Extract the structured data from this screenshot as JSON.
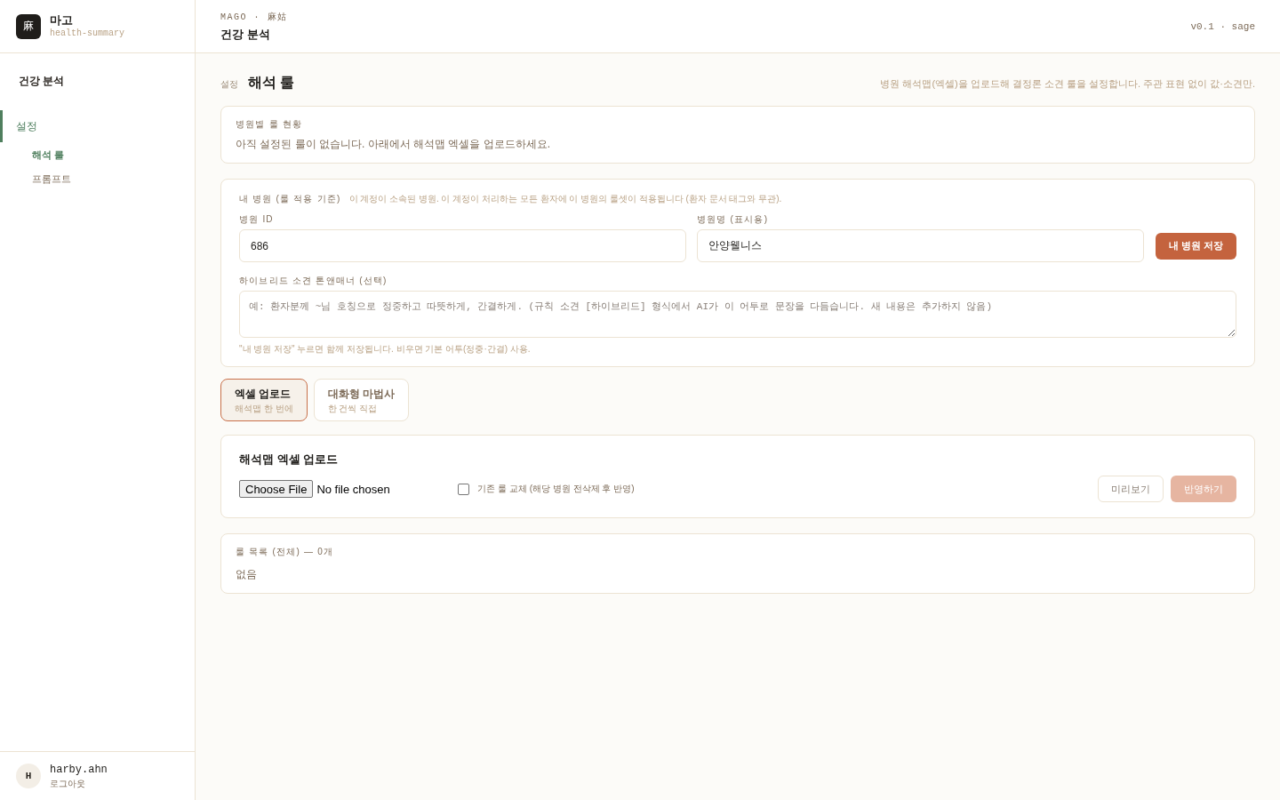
{
  "sidebar": {
    "logo": {
      "glyph": "麻",
      "name": "마고",
      "subtitle": "health-summary"
    },
    "section_title": "건강 분석",
    "nav": [
      {
        "label": "설정",
        "selected": true,
        "children": [
          {
            "label": "해석 룰",
            "selected": true
          },
          {
            "label": "프롬프트",
            "selected": false
          }
        ]
      }
    ],
    "user": {
      "avatar": "H",
      "name": "harby.ahn",
      "action": "로그아웃"
    }
  },
  "header": {
    "breadcrumb": "MAGO · 麻姑",
    "title": "건강 분석",
    "version": "v0.1 · sage"
  },
  "page": {
    "eyebrow": "설정",
    "title": "해석 룰",
    "description": "병원 해석맵(엑셀)을 업로드해 결정론 소견 룰을 설정합니다. 주관 표현 없이 값·소견만."
  },
  "status_card": {
    "title": "병원별 룰 현황",
    "message": "아직 설정된 룰이 없습니다. 아래에서 해석맵 엑셀을 업로드하세요."
  },
  "hospital_card": {
    "title": "내 병원 (룰 적용 기준)",
    "description": "이 계정이 소속된 병원. 이 계정이 처리하는 모든 환자에 이 병원의 룰셋이 적용됩니다 (환자 문서 태그와 무관).",
    "fields": [
      {
        "label": "병원 ID",
        "value": "686"
      },
      {
        "label": "병원명 (표시용)",
        "value": "안양웰니스"
      }
    ],
    "save_button": "내 병원 저장",
    "tone": {
      "label": "하이브리드 소견 톤앤매너 (선택)",
      "placeholder": "예: 환자분께 ~님 호칭으로 정중하고 따뜻하게, 간결하게. (규칙 소견 [하이브리드] 형식에서 AI가 이 어투로 문장을 다듬습니다. 새 내용은 추가하지 않음)",
      "hint": "\"내 병원 저장\" 누르면 함께 저장됩니다. 비우면 기본 어투(정중·간결) 사용."
    }
  },
  "mode_tabs": [
    {
      "title": "엑셀 업로드",
      "subtitle": "해석맵 한 번에",
      "selected": true
    },
    {
      "title": "대화형 마법사",
      "subtitle": "한 건씩 직접",
      "selected": false
    }
  ],
  "upload_card": {
    "title": "해석맵 엑셀 업로드",
    "file_button": "Choose File",
    "file_status": "No file chosen",
    "replace": {
      "label": "기존 룰 교체 (해당 병원 전삭제 후 반영)",
      "checked": false
    },
    "buttons": [
      {
        "label": "미리보기",
        "kind": "secondary",
        "disabled": false
      },
      {
        "label": "반영하기",
        "kind": "primary",
        "disabled": true
      }
    ]
  },
  "rules_card": {
    "title": "룰 목록 (전체) — 0개",
    "empty": "없음"
  }
}
